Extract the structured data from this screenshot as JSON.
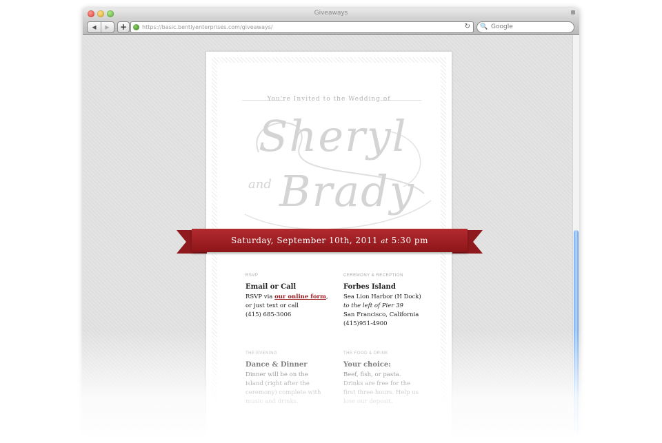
{
  "browser": {
    "window_title": "Giveaways",
    "url": "https://basic.bentlyenterprises.com/giveaways/",
    "search_placeholder": "Google",
    "nav_back": "◀",
    "nav_forward": "▶",
    "add_label": "+",
    "reload": "↻",
    "search_icon": "🔍"
  },
  "invitation": {
    "invited_line": "You're Invited to the Wedding of",
    "name_first": "Sheryl",
    "name_and": "and",
    "name_second": "Brady",
    "ribbon": {
      "date": "Saturday, September 10th, 2011",
      "at": "at",
      "time": "5:30 pm"
    },
    "rsvp": {
      "label": "RSVP",
      "heading": "Email or Call",
      "line1_pre": "RSVP via",
      "link": "our online form",
      "line1_post": ", or just text or call",
      "phone": "(415) 685-3006"
    },
    "ceremony": {
      "label": "Ceremony & Reception",
      "heading": "Forbes Island",
      "line1": "Sea Lion Harbor (H Dock)",
      "line2": "to the left of Pier 39",
      "line3": "San Francisco, California",
      "phone": "(415)951-4900"
    },
    "evening": {
      "label": "The Evening",
      "heading": "Dance & Dinner",
      "line1": "Dinner will be on the",
      "line2": "island (right after the",
      "line3": "ceremony) complete with",
      "line4": "music and drinks."
    },
    "food": {
      "label": "The Food & Drink",
      "heading": "Your choice:",
      "line1": "Beef, fish, or pasta.",
      "line2": "Drinks are free for the",
      "line3": "first three hours. Help us",
      "line4": "lose our deposit."
    }
  },
  "colors": {
    "ribbon": "#a31f24",
    "link": "#9b1b20",
    "scroll_thumb": "#6ea7ee"
  }
}
